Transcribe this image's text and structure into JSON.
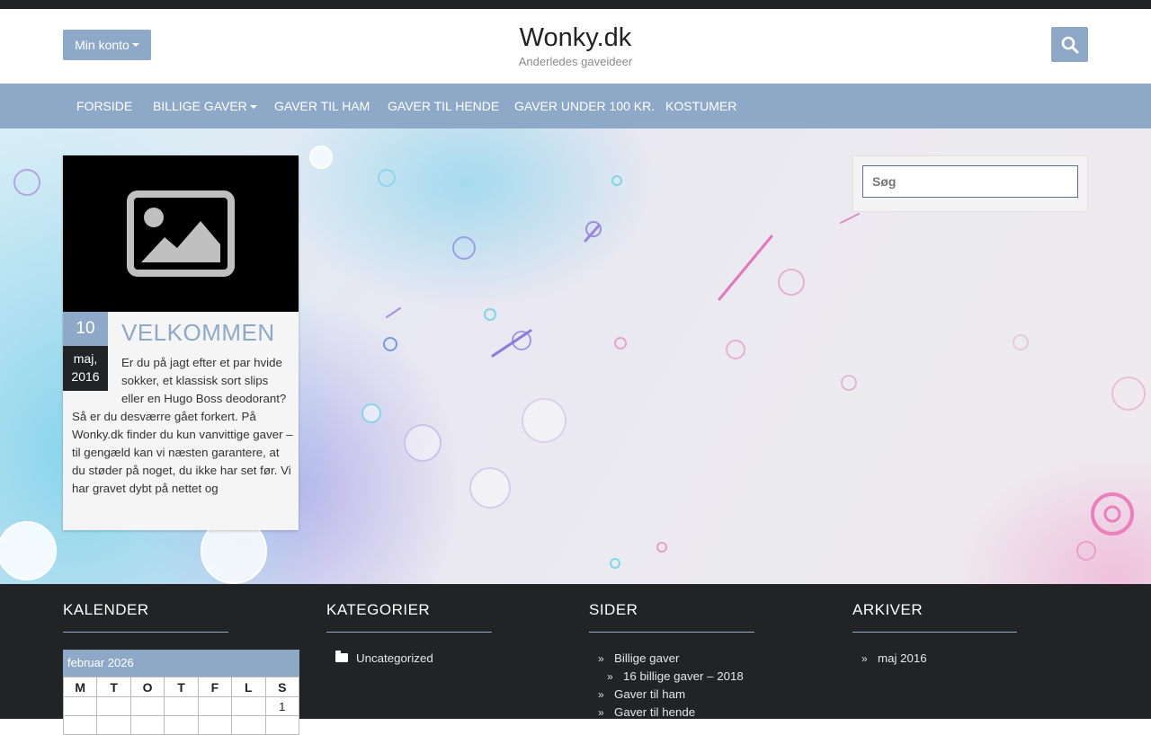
{
  "header": {
    "account_label": "Min konto",
    "site_title": "Wonky.dk",
    "site_description": "Anderledes gaveideer",
    "search_icon": "search-icon"
  },
  "nav": {
    "items": [
      {
        "label": "FORSIDE"
      },
      {
        "label": "BILLIGE GAVER",
        "has_dropdown": true
      },
      {
        "label": "GAVER TIL HAM"
      },
      {
        "label": "GAVER TIL HENDE"
      },
      {
        "label": "GAVER UNDER 100 KR."
      },
      {
        "label": "KOSTUMER"
      }
    ]
  },
  "post": {
    "day": "10",
    "month": "maj,",
    "year": "2016",
    "title": "VELKOMMEN",
    "excerpt_first": "Er du på jagt efter et par hvide sokker, et klassisk sort slips eller en Hugo Boss deodorant?",
    "excerpt_rest": "Så er du desværre gået forkert. På Wonky.dk finder du kun vanvittige gaver – til gengæld kan vi næsten garantere, at du støder på noget, du ikke har set før. Vi har gravet dybt på nettet og",
    "thumbnail_icon": "image-placeholder-icon"
  },
  "sidebar": {
    "search_placeholder": "Søg"
  },
  "footer": {
    "calendar": {
      "heading": "KALENDER",
      "caption": "februar 2026",
      "weekdays": [
        "M",
        "T",
        "O",
        "T",
        "F",
        "L",
        "S"
      ],
      "first_row": [
        "",
        "",
        "",
        "",
        "",
        "",
        "1"
      ]
    },
    "categories": {
      "heading": "KATEGORIER",
      "items": [
        "Uncategorized"
      ]
    },
    "pages": {
      "heading": "SIDER",
      "items": [
        "Billige gaver",
        "16 billige gaver – 2018",
        "Gaver til ham",
        "Gaver til hende"
      ]
    },
    "archives": {
      "heading": "ARKIVER",
      "items": [
        "maj 2016"
      ]
    }
  },
  "colors": {
    "accent": "#8ea9c8",
    "dark": "#222325"
  }
}
